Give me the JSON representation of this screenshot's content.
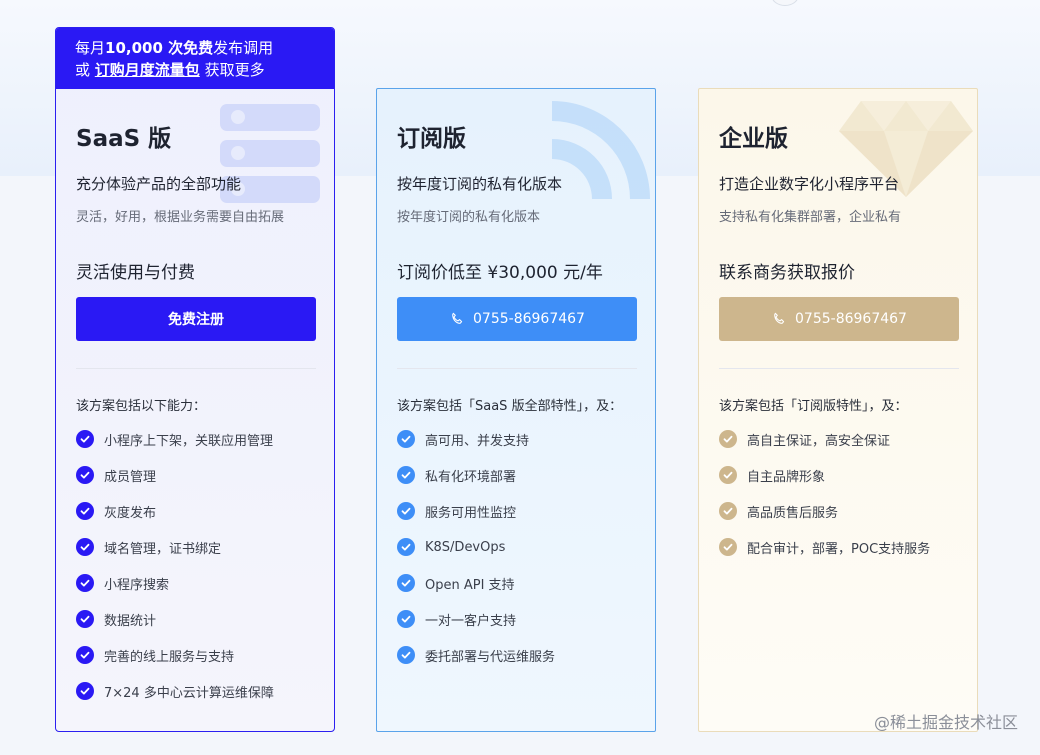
{
  "saas": {
    "banner": {
      "line1_prefix": "每月",
      "line1_bold": "10,000 次免费",
      "line1_suffix": "发布调用",
      "line2_prefix": "或 ",
      "line2_link": "订购月度流量包",
      "line2_suffix": " 获取更多"
    },
    "title": "SaaS 版",
    "desc": "充分体验产品的全部功能",
    "desc2": "灵活，好用，根据业务需要自由拓展",
    "price": "灵活使用与付费",
    "button": "免费注册",
    "features_title": "该方案包括以下能力：",
    "features": [
      "小程序上下架，关联应用管理",
      "成员管理",
      "灰度发布",
      "域名管理，证书绑定",
      "小程序搜索",
      "数据统计",
      "完善的线上服务与支持",
      "7×24 多中心云计算运维保障"
    ],
    "accent": "#2a19f4"
  },
  "subscription": {
    "title": "订阅版",
    "desc": "按年度订阅的私有化版本",
    "desc2": "按年度订阅的私有化版本",
    "price": "订阅价低至 ¥30,000 元/年",
    "button": "0755-86967467",
    "features_title": "该方案包括「SaaS 版全部特性」，及：",
    "features": [
      "高可用、并发支持",
      "私有化环境部署",
      "服务可用性监控",
      "K8S/DevOps",
      "Open API 支持",
      "一对一客户支持",
      "委托部署与代运维服务"
    ],
    "accent": "#3e8ef7"
  },
  "enterprise": {
    "title": "企业版",
    "desc": "打造企业数字化小程序平台",
    "desc2": "支持私有化集群部署，企业私有",
    "price": "联系商务获取报价",
    "button": "0755-86967467",
    "features_title": "该方案包括「订阅版特性」，及：",
    "features": [
      "高自主保证，高安全保证",
      "自主品牌形象",
      "高品质售后服务",
      "配合审计，部署，POC支持服务"
    ],
    "accent": "#cdb68d"
  },
  "watermark": "@稀土掘金技术社区"
}
